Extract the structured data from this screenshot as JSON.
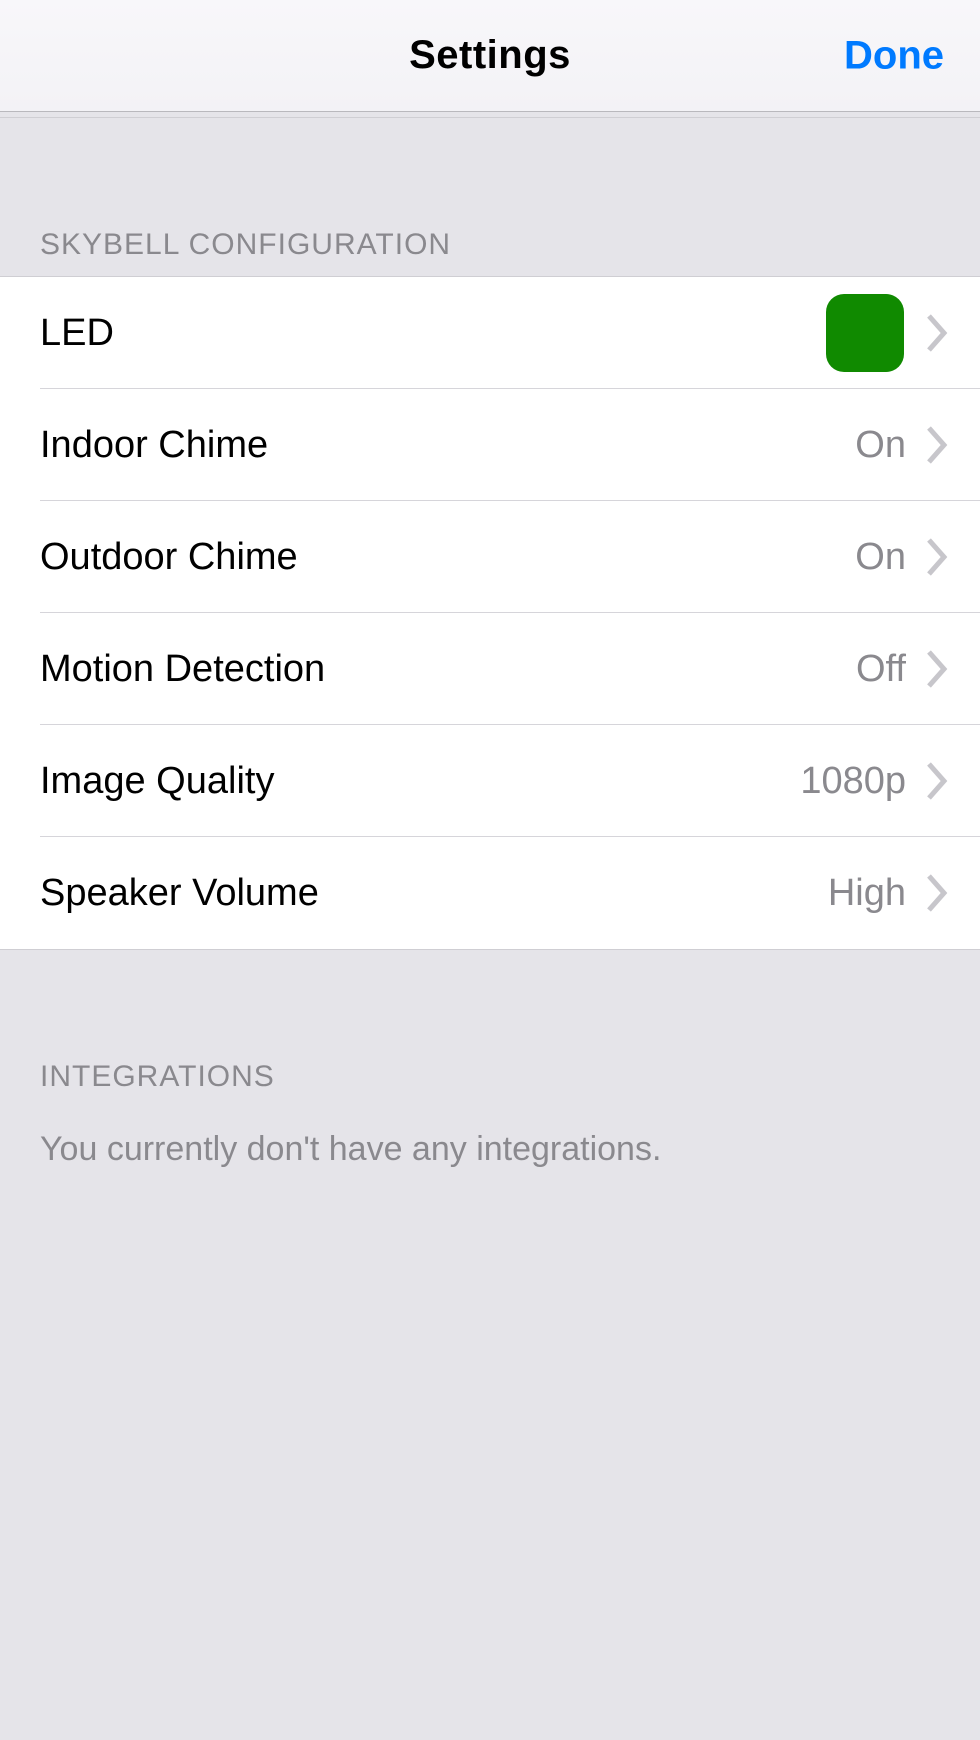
{
  "nav": {
    "title": "Settings",
    "done": "Done"
  },
  "section_config": {
    "header": "SKYBELL CONFIGURATION",
    "rows": {
      "led": {
        "label": "LED",
        "color": "#108a00"
      },
      "indoor_chime": {
        "label": "Indoor Chime",
        "value": "On"
      },
      "outdoor_chime": {
        "label": "Outdoor Chime",
        "value": "On"
      },
      "motion_detection": {
        "label": "Motion Detection",
        "value": "Off"
      },
      "image_quality": {
        "label": "Image Quality",
        "value": "1080p"
      },
      "speaker_volume": {
        "label": "Speaker Volume",
        "value": "High"
      }
    }
  },
  "section_integrations": {
    "header": "INTEGRATIONS",
    "empty_text": "You currently don't have any integrations."
  }
}
